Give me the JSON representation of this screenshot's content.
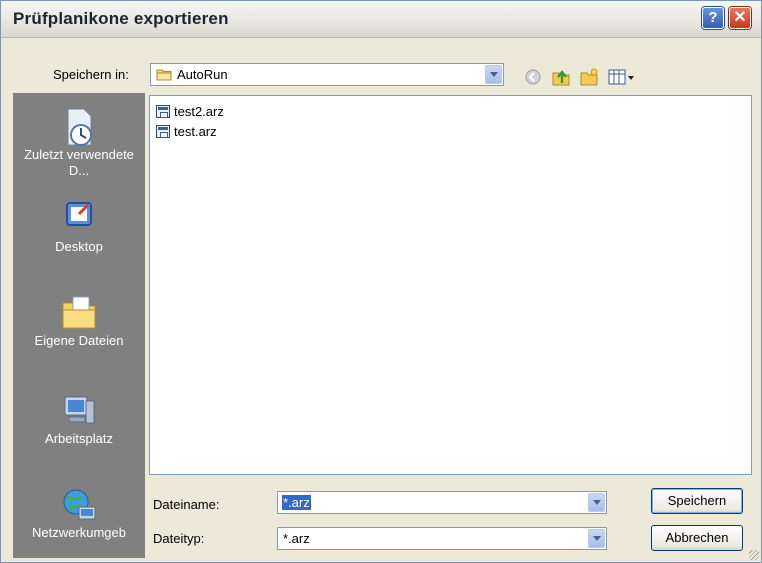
{
  "window": {
    "title": "Prüfplanikone exportieren",
    "help_glyph": "?",
    "close_glyph": "✕"
  },
  "save_in": {
    "label": "Speichern in:",
    "value": "AutoRun"
  },
  "toolbar": {
    "icons": [
      "back-icon",
      "up-folder-icon",
      "new-folder-icon",
      "view-menu-icon"
    ]
  },
  "places": [
    {
      "label": "Zuletzt verwendete D...",
      "icon": "recent-documents-icon"
    },
    {
      "label": "Desktop",
      "icon": "desktop-icon"
    },
    {
      "label": "Eigene Dateien",
      "icon": "my-documents-icon"
    },
    {
      "label": "Arbeitsplatz",
      "icon": "my-computer-icon"
    },
    {
      "label": "Netzwerkumgeb",
      "icon": "network-icon"
    }
  ],
  "files": [
    {
      "name": "test2.arz"
    },
    {
      "name": "test.arz"
    }
  ],
  "filename": {
    "label": "Dateiname:",
    "value": "*.arz"
  },
  "filetype": {
    "label": "Dateityp:",
    "value": "*.arz"
  },
  "buttons": {
    "save": "Speichern",
    "cancel": "Abbrechen"
  },
  "colors": {
    "places_bar": "#808080",
    "dialog_bg": "#ece9d8",
    "accent_blue": "#3a6ea5"
  }
}
